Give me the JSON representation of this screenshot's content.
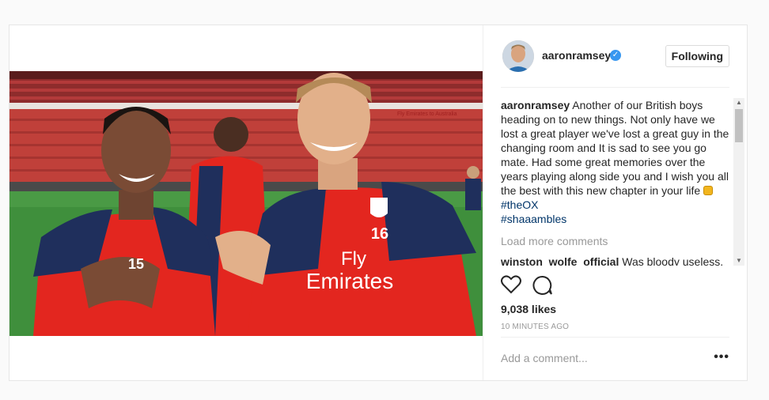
{
  "post": {
    "username": "aaronramsey",
    "follow_button": "Following",
    "caption": {
      "user": "aaronramsey",
      "text": " Another of our British boys heading on to new things. Not only have we lost a great player we've lost a great guy in the changing room and It is sad to see you go mate. Had some great memories over the years playing along side you and I wish you all the best with this new chapter in your life ",
      "hashtag_1": "#theOX",
      "hashtag_2": "#shaaambles"
    },
    "load_more": "Load more comments",
    "comment": {
      "user": "winston_wolfe_official",
      "text": " Was bloody useless,"
    },
    "likes": "9,038 likes",
    "time": "10 MINUTES AGO",
    "add_comment_placeholder": "Add a comment...",
    "photo": {
      "shirt_text_1": "Fly",
      "shirt_text_2": "Emirates",
      "number_left": "15",
      "number_right": "16",
      "stadium_banner": "Fly Emirates to Australia"
    }
  },
  "colors": {
    "verified": "#3897f0",
    "hashtag": "#003569",
    "arsenal_red": "#e3261f",
    "arsenal_navy": "#1f2f5c"
  },
  "icons": {
    "like": "heart-icon",
    "comment": "comment-icon",
    "verified": "verified-badge-icon",
    "more": "more-options-icon"
  }
}
